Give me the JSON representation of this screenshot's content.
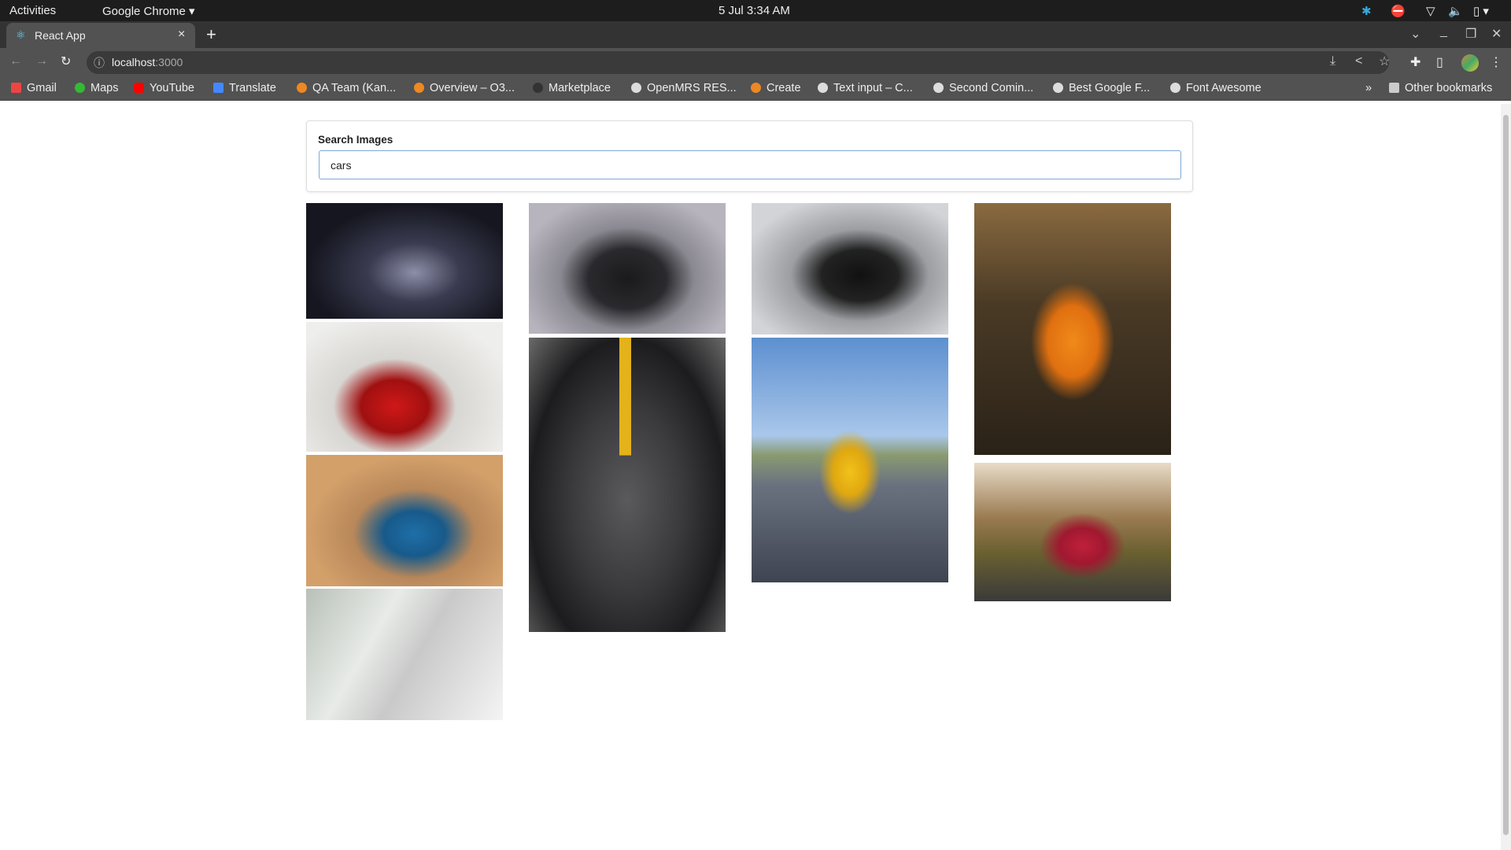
{
  "system": {
    "activities": "Activities",
    "app": "Google Chrome ▾",
    "datetime": "5 Jul  3:34 AM"
  },
  "browser": {
    "tab_title": "React App",
    "close": "×",
    "new_tab": "+",
    "url_host": "localhost",
    "url_port": ":3000",
    "bookmarks": [
      "Gmail",
      "Maps",
      "YouTube",
      "Translate",
      "QA Team (Kan...",
      "Overview – O3...",
      "Marketplace",
      "OpenMRS RES...",
      "Create",
      "Text input – C...",
      "Second Comin...",
      "Best Google F...",
      "Font Awesome"
    ],
    "more": "»",
    "other_bookmarks": "Other bookmarks"
  },
  "search": {
    "label": "Search Images",
    "value": "cars"
  },
  "images": [
    "dark-camaro-garage",
    "black-mustang",
    "black-porsche-panamera",
    "orange-lamborghini",
    "red-laferrari",
    "grey-mercedes-amg-hood",
    "yellow-mercedes-amg-gt",
    "red-mercedes-amg-gt-forest",
    "blue-camaro-desert",
    "classic-bmw-row"
  ]
}
